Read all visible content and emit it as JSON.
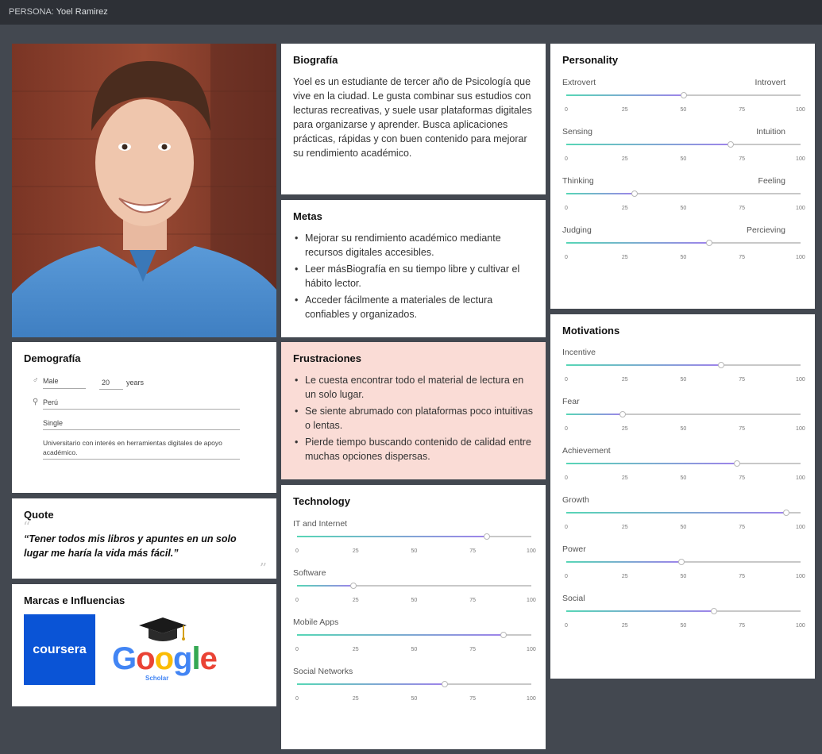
{
  "topbar": {
    "prefix": "PERSONA:",
    "name": "Yoel Ramirez"
  },
  "bio": {
    "title": "Biografía",
    "text": "Yoel es un estudiante de tercer año de Psicología que vive en la ciudad.  Le gusta combinar sus estudios con lecturas recreativas, y suele usar plataformas digitales para organizarse y aprender. Busca aplicaciones prácticas, rápidas y con buen contenido para mejorar su rendimiento académico."
  },
  "metas": {
    "title": "Metas",
    "items": [
      "Mejorar su rendimiento académico mediante recursos digitales accesibles.",
      "Leer másBiografía en su tiempo libre y cultivar el hábito lector.",
      "Acceder fácilmente a materiales de lectura confiables y organizados."
    ]
  },
  "frustraciones": {
    "title": "Frustraciones",
    "items": [
      "Le cuesta encontrar todo el material de lectura en un solo lugar.",
      "Se siente abrumado con plataformas poco intuitivas o lentas.",
      "Pierde tiempo buscando contenido de calidad entre muchas opciones dispersas."
    ]
  },
  "demografia": {
    "title": "Demografía",
    "gender": "Male",
    "age": "20",
    "age_unit": "years",
    "location": "Perú",
    "status": "Single",
    "occupation": "Universitario con interés en herramientas digitales de apoyo académico."
  },
  "quote": {
    "title": "Quote",
    "text": "“Tener todos mis libros y apuntes en un solo lugar me haría la vida más fácil.”"
  },
  "brands": {
    "title": "Marcas e Influencias",
    "coursera": "coursera",
    "google": [
      "G",
      "o",
      "o",
      "g",
      "l",
      "e"
    ],
    "scholar": "Scholar"
  },
  "ticks": [
    "0",
    "25",
    "50",
    "75",
    "100"
  ],
  "technology": {
    "title": "Technology",
    "items": [
      {
        "label": "IT and Internet",
        "value": 81
      },
      {
        "label": "Software",
        "value": 24
      },
      {
        "label": "Mobile Apps",
        "value": 88
      },
      {
        "label": "Social Networks",
        "value": 63
      }
    ]
  },
  "personality": {
    "title": "Personality",
    "items": [
      {
        "left": "Extrovert",
        "right": "Introvert",
        "value": 50
      },
      {
        "left": "Sensing",
        "right": "Intuition",
        "value": 70
      },
      {
        "left": "Thinking",
        "right": "Feeling",
        "value": 29
      },
      {
        "left": "Judging",
        "right": "Percieving",
        "value": 61
      }
    ]
  },
  "motivations": {
    "title": "Motivations",
    "items": [
      {
        "label": "Incentive",
        "value": 66
      },
      {
        "label": "Fear",
        "value": 24
      },
      {
        "label": "Achievement",
        "value": 73
      },
      {
        "label": "Growth",
        "value": 94
      },
      {
        "label": "Power",
        "value": 49
      },
      {
        "label": "Social",
        "value": 63
      }
    ]
  },
  "colors": {
    "fill_start": "#57d6b6",
    "fill_end": "#9e83ea",
    "frustration_bg": "#fadcd6",
    "coursera_blue": "#0a54d6"
  }
}
